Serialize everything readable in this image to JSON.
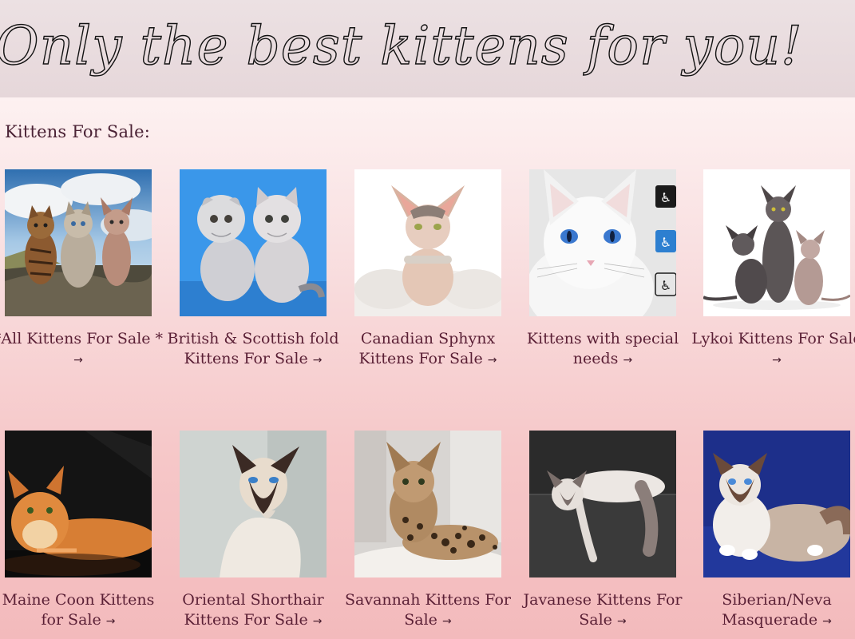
{
  "banner": {
    "title": "Only the best kittens for you!"
  },
  "section": {
    "heading": "Kittens For Sale:"
  },
  "arrow_glyph": "→",
  "categories": [
    {
      "label": "*All Kittens For Sale *",
      "image": "three-cats-rock-photo"
    },
    {
      "label": "British & Scottish fold Kittens For Sale",
      "image": "british-scottish-kittens-photo"
    },
    {
      "label": "Canadian Sphynx Kittens For Sale",
      "image": "sphynx-kitten-photo"
    },
    {
      "label": "Kittens with special needs",
      "image": "white-cat-accessibility-photo"
    },
    {
      "label": "Lykoi Kittens For Sale",
      "image": "lykoi-cats-photo"
    },
    {
      "label": "Maine Coon Kittens for Sale",
      "image": "maine-coon-photo"
    },
    {
      "label": "Oriental Shorthair Kittens For Sale",
      "image": "oriental-shorthair-photo"
    },
    {
      "label": "Savannah Kittens For Sale",
      "image": "savannah-kitten-photo"
    },
    {
      "label": "Javanese Kittens For Sale",
      "image": "javanese-cat-photo"
    },
    {
      "label": "Siberian/Neva Masquerade",
      "image": "siberian-neva-photo"
    }
  ],
  "colors": {
    "title_text": "#5a1f35",
    "banner_bg": "#e9dcdf",
    "page_bg_top": "#fdf1f1",
    "page_bg_bottom": "#f3babc",
    "accessibility_icon": "#2d7fd0"
  }
}
